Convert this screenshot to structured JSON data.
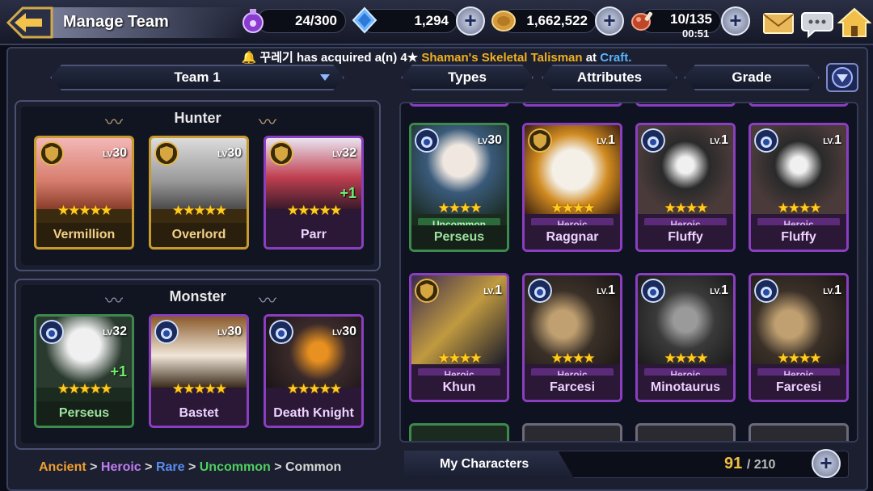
{
  "header": {
    "title": "Manage Team",
    "stamina": "24/300",
    "gems": "1,294",
    "gold": "1,662,522",
    "meat": "10/135",
    "meat_timer": "00:51"
  },
  "ticker": {
    "prefix": "🔔 꾸레기 has acquired a(n) 4★ ",
    "item": "Shaman's Skeletal Talisman",
    "mid": " at ",
    "place": "Craft."
  },
  "filters": {
    "team": "Team 1",
    "types": "Types",
    "attributes": "Attributes",
    "grade": "Grade"
  },
  "hunter_panel": {
    "title": "Hunter",
    "cards": [
      {
        "name": "Vermillion",
        "level": "30",
        "rarity": "ancient",
        "stars": "★★★★★",
        "bonus": ""
      },
      {
        "name": "Overlord",
        "level": "30",
        "rarity": "ancient",
        "stars": "★★★★★",
        "bonus": ""
      },
      {
        "name": "Parr",
        "level": "32",
        "rarity": "heroic",
        "stars": "★★★★★",
        "bonus": "+1"
      }
    ]
  },
  "monster_panel": {
    "title": "Monster",
    "cards": [
      {
        "name": "Perseus",
        "level": "32",
        "rarity": "uncommon",
        "stars": "★★★★★",
        "bonus": "+1"
      },
      {
        "name": "Bastet",
        "level": "30",
        "rarity": "heroic",
        "stars": "★★★★★",
        "bonus": ""
      },
      {
        "name": "Death Knight",
        "level": "30",
        "rarity": "heroic",
        "stars": "★★★★★",
        "bonus": ""
      }
    ]
  },
  "roster": {
    "cards": [
      {
        "name": "Perseus",
        "level": "30",
        "rarity": "uncommon",
        "rarity_label": "Uncommon",
        "stars": "★★★★"
      },
      {
        "name": "Raggnar",
        "level": "1",
        "rarity": "heroic",
        "rarity_label": "Heroic",
        "stars": "★★★★"
      },
      {
        "name": "Fluffy",
        "level": "1",
        "rarity": "heroic",
        "rarity_label": "Heroic",
        "stars": "★★★★"
      },
      {
        "name": "Fluffy",
        "level": "1",
        "rarity": "heroic",
        "rarity_label": "Heroic",
        "stars": "★★★★"
      },
      {
        "name": "Khun",
        "level": "1",
        "rarity": "heroic",
        "rarity_label": "Heroic",
        "stars": "★★★★"
      },
      {
        "name": "Farcesi",
        "level": "1",
        "rarity": "heroic",
        "rarity_label": "Heroic",
        "stars": "★★★★"
      },
      {
        "name": "Minotaurus",
        "level": "1",
        "rarity": "heroic",
        "rarity_label": "Heroic",
        "stars": "★★★★"
      },
      {
        "name": "Farcesi",
        "level": "1",
        "rarity": "heroic",
        "rarity_label": "Heroic",
        "stars": "★★★★"
      }
    ]
  },
  "legend": {
    "ancient": "Ancient",
    "heroic": "Heroic",
    "rare": "Rare",
    "uncommon": "Uncommon",
    "common": "Common",
    "sep": " > "
  },
  "footer": {
    "tab": "My Characters",
    "owned": "91",
    "capacity": "/ 210"
  },
  "colors": {
    "ancient": "#c99a2e",
    "heroic": "#8a3ec0",
    "uncommon": "#3c8a4c",
    "star": "#ffcc1e"
  }
}
